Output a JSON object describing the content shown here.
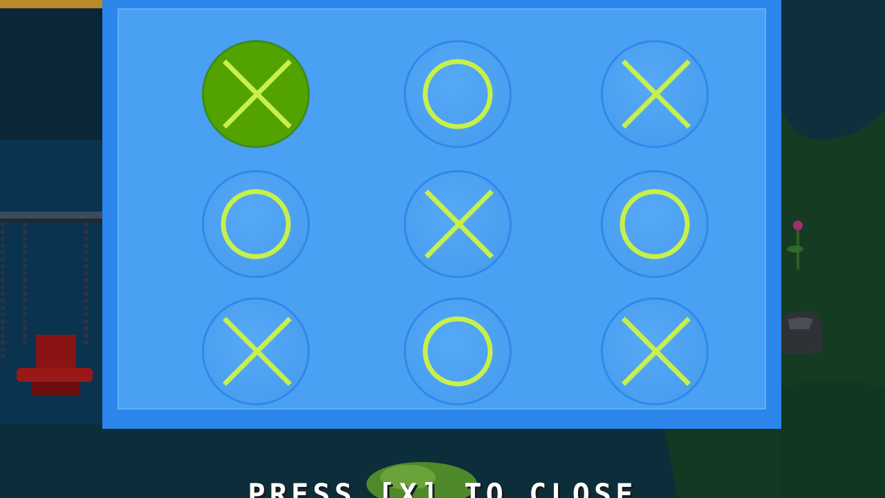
{
  "game": {
    "board": {
      "selected_cell": 0,
      "cells": [
        {
          "row": 1,
          "col": 1,
          "mark": "X",
          "icon": "x-mark-icon"
        },
        {
          "row": 1,
          "col": 2,
          "mark": "O",
          "icon": "o-mark-icon"
        },
        {
          "row": 1,
          "col": 3,
          "mark": "X",
          "icon": "x-mark-icon"
        },
        {
          "row": 2,
          "col": 1,
          "mark": "O",
          "icon": "o-mark-icon"
        },
        {
          "row": 2,
          "col": 2,
          "mark": "X",
          "icon": "x-mark-icon"
        },
        {
          "row": 2,
          "col": 3,
          "mark": "O",
          "icon": "o-mark-icon"
        },
        {
          "row": 3,
          "col": 1,
          "mark": "X",
          "icon": "x-mark-icon"
        },
        {
          "row": 3,
          "col": 2,
          "mark": "O",
          "icon": "o-mark-icon"
        },
        {
          "row": 3,
          "col": 3,
          "mark": "X",
          "icon": "x-mark-icon"
        }
      ]
    },
    "close_hint": "PRESS [X] TO CLOSE"
  },
  "colors": {
    "panel_border": "#2c86ec",
    "panel_fill": "#4aa0f2",
    "cell_fill": "#4ca0f1",
    "cell_selected": "#53a300",
    "mark": "#c8f04a",
    "background_water": "#0c2a3b",
    "background_grass": "#173f22"
  }
}
